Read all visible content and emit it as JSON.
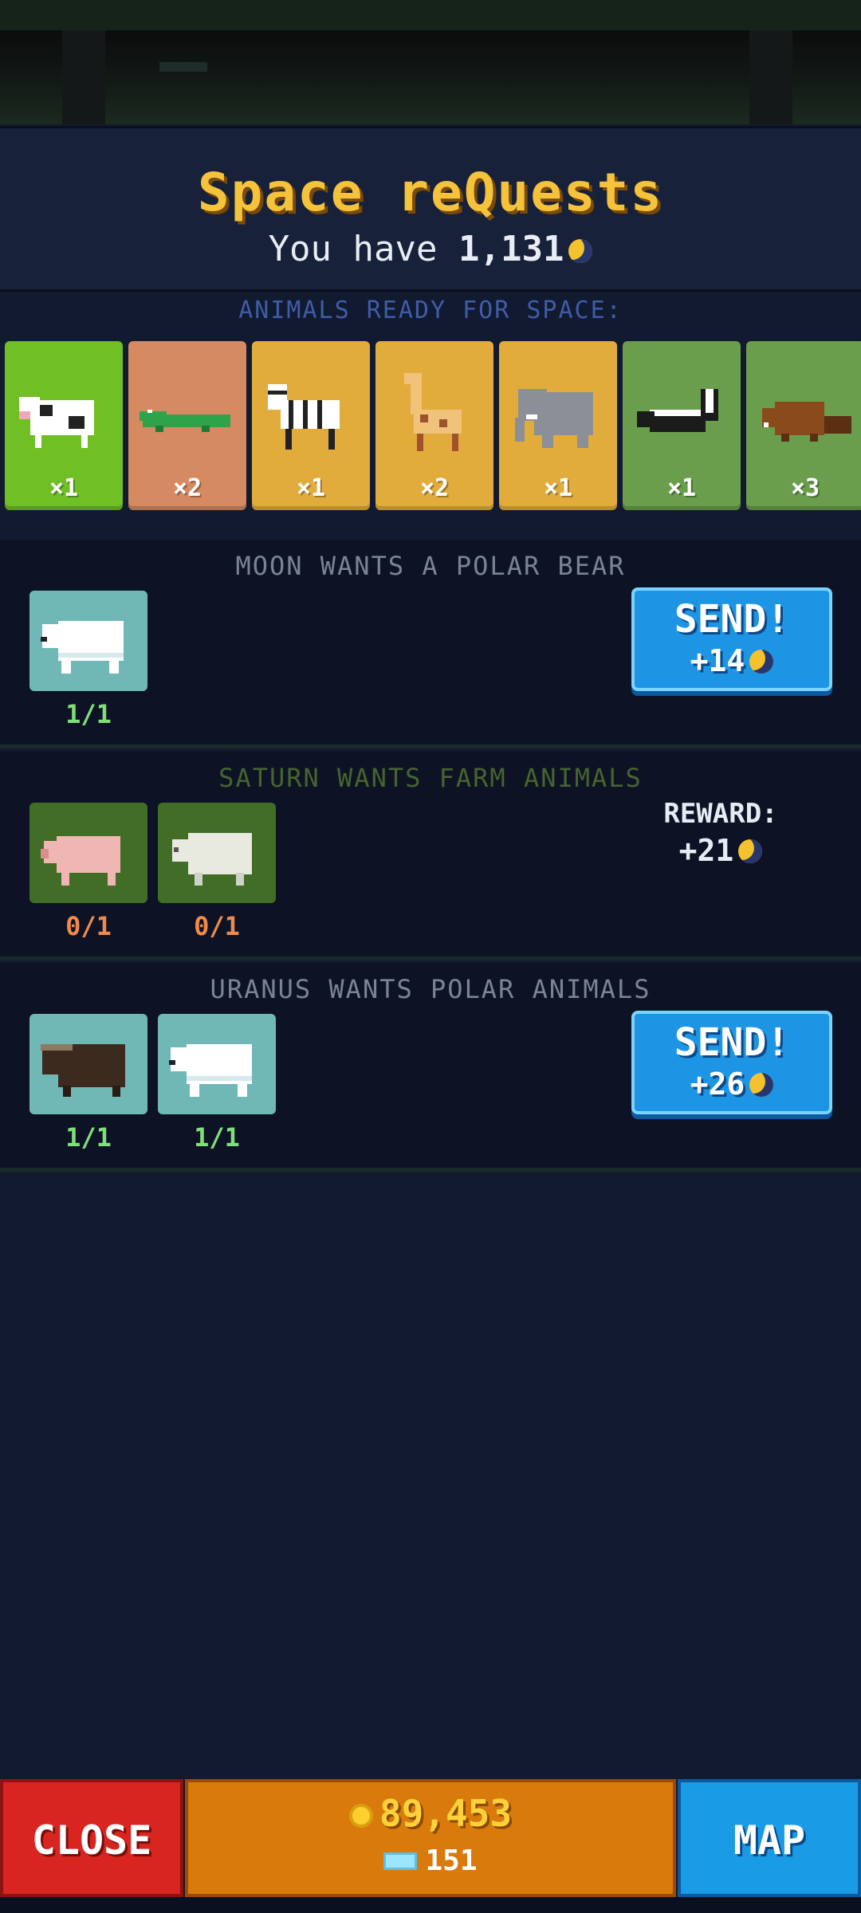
{
  "header": {
    "title": "Space reQuests",
    "have_prefix": "You have",
    "have_amount": "1,131",
    "currency_icon": "moon-token-icon"
  },
  "ready": {
    "label": "ANIMALS READY FOR SPACE:",
    "animals": [
      {
        "name": "cow",
        "qty": "×1",
        "color": "#6fbf25"
      },
      {
        "name": "crocodile",
        "qty": "×2",
        "color": "#d58a62"
      },
      {
        "name": "zebra",
        "qty": "×1",
        "color": "#e2ac3d"
      },
      {
        "name": "giraffe",
        "qty": "×2",
        "color": "#e2ac3d"
      },
      {
        "name": "elephant",
        "qty": "×1",
        "color": "#e2ac3d"
      },
      {
        "name": "skunk",
        "qty": "×1",
        "color": "#6a9e4c"
      },
      {
        "name": "beaver",
        "qty": "×3",
        "color": "#6a9e4c"
      }
    ]
  },
  "requests": [
    {
      "title": "MOON WANTS A POLAR BEAR",
      "title_color": "#7b8396",
      "slots": [
        {
          "animal": "polar-bear",
          "count": "1/1",
          "ok": true
        }
      ],
      "action": {
        "type": "send",
        "label": "SEND!",
        "reward": "+14"
      }
    },
    {
      "title": "SATURN WANTS FARM ANIMALS",
      "title_color": "#47632f",
      "slots": [
        {
          "animal": "pig",
          "count": "0/1",
          "ok": false
        },
        {
          "animal": "sheep",
          "count": "0/1",
          "ok": false
        }
      ],
      "action": {
        "type": "reward",
        "label": "REWARD:",
        "reward": "+21"
      }
    },
    {
      "title": "URANUS WANTS POLAR ANIMALS",
      "title_color": "#7b8396",
      "slots": [
        {
          "animal": "musk-ox",
          "count": "1/1",
          "ok": true
        },
        {
          "animal": "polar-bear",
          "count": "1/1",
          "ok": true
        }
      ],
      "action": {
        "type": "send",
        "label": "SEND!",
        "reward": "+26"
      }
    }
  ],
  "footer": {
    "close_label": "CLOSE",
    "coins": "89,453",
    "gems": "151",
    "map_label": "MAP"
  },
  "colors": {
    "ok_count": "#7fe07a",
    "missing_count": "#f08a4b",
    "slot_polar": "#6fb8b6",
    "slot_farm": "#416d26"
  }
}
